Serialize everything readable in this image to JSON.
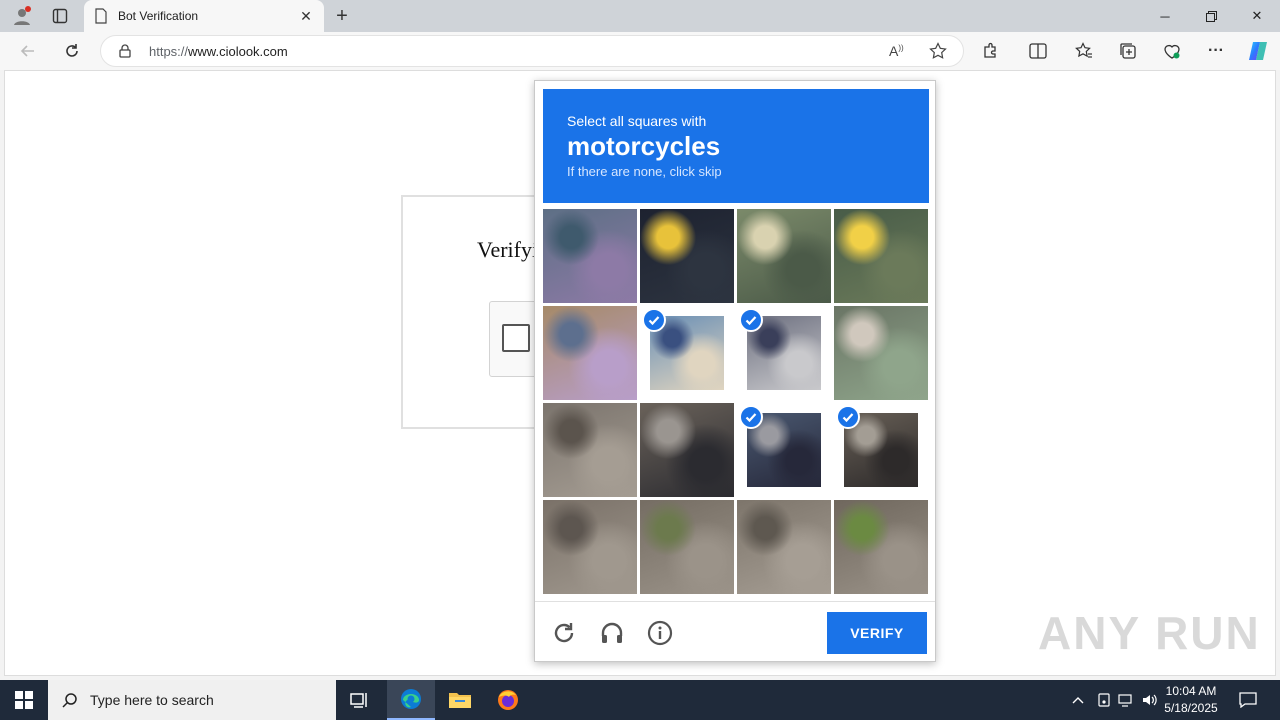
{
  "browser": {
    "tab_title": "Bot Verification",
    "url_protocol": "https://",
    "url_host": "www.ciolook.com"
  },
  "page": {
    "heading": "Verifyi"
  },
  "captcha": {
    "instruction": "Select all squares with",
    "target": "motorcycles",
    "hint": "If there are none, click skip",
    "verify_label": "VERIFY",
    "tiles": [
      {
        "selected": false
      },
      {
        "selected": false
      },
      {
        "selected": false
      },
      {
        "selected": false
      },
      {
        "selected": false
      },
      {
        "selected": true
      },
      {
        "selected": true
      },
      {
        "selected": false
      },
      {
        "selected": false
      },
      {
        "selected": false
      },
      {
        "selected": true
      },
      {
        "selected": true
      },
      {
        "selected": false
      },
      {
        "selected": false
      },
      {
        "selected": false
      },
      {
        "selected": false
      }
    ],
    "accent_color": "#1a73e8"
  },
  "watermark": "ANY RUN",
  "taskbar": {
    "search_placeholder": "Type here to search",
    "time": "10:04 AM",
    "date": "5/18/2025"
  }
}
